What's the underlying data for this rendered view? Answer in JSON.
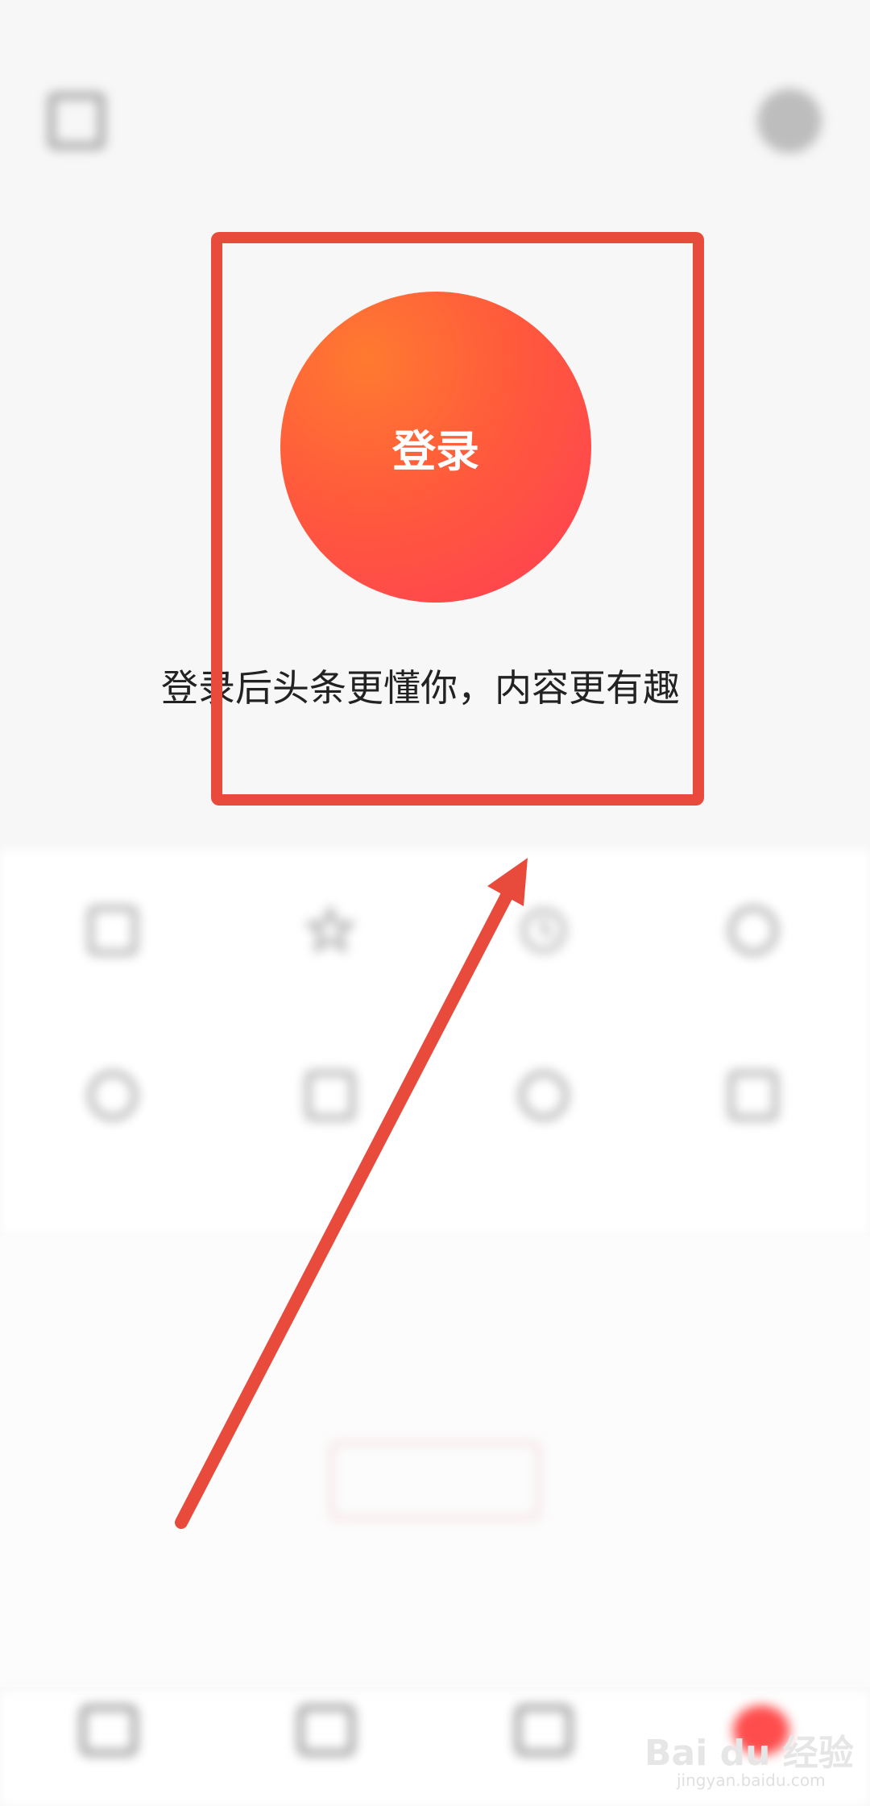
{
  "status_bar": {
    "left_text": "",
    "right_text": ""
  },
  "login": {
    "button_label": "登录",
    "prompt": "登录后头条更懂你，内容更有趣"
  },
  "grid": {
    "items": [
      {
        "label": "",
        "icon": "message-icon"
      },
      {
        "label": "",
        "icon": "star-icon"
      },
      {
        "label": "",
        "icon": "clock-icon"
      },
      {
        "label": "",
        "icon": "download-icon"
      },
      {
        "label": "",
        "icon": "thumbs-up-icon"
      },
      {
        "label": "",
        "icon": "folder-icon"
      },
      {
        "label": "",
        "icon": "search-icon"
      },
      {
        "label": "",
        "icon": "list-icon"
      }
    ]
  },
  "bottom": {
    "history_tip": "",
    "history_button": ""
  },
  "tabs": [
    {
      "label": "",
      "icon": "home-icon"
    },
    {
      "label": "",
      "icon": "video-icon"
    },
    {
      "label": "",
      "icon": "chat-icon"
    },
    {
      "label": "",
      "icon": "user-icon"
    }
  ],
  "watermark": {
    "main": "Bai du 经验",
    "sub": "jingyan.baidu.com"
  },
  "annotation": {
    "color": "#e84a3c"
  }
}
